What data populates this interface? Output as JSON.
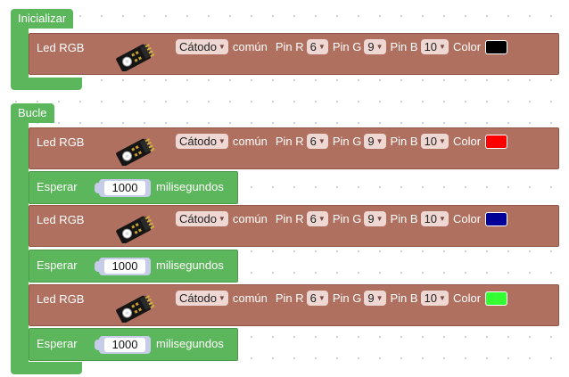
{
  "setup": {
    "label": "Inicializar",
    "led": {
      "label": "Led RGB",
      "cathode": "Cátodo",
      "common": "común",
      "pin_r_label": "Pin R",
      "pin_r": "6",
      "pin_g_label": "Pin G",
      "pin_g": "9",
      "pin_b_label": "Pin B",
      "pin_b": "10",
      "color_label": "Color",
      "color": "#000000"
    }
  },
  "loop": {
    "label": "Bucle",
    "steps": [
      {
        "led": {
          "label": "Led RGB",
          "cathode": "Cátodo",
          "common": "común",
          "pin_r_label": "Pin R",
          "pin_r": "6",
          "pin_g_label": "Pin G",
          "pin_g": "9",
          "pin_b_label": "Pin B",
          "pin_b": "10",
          "color_label": "Color",
          "color": "#ff0000"
        },
        "wait": {
          "label": "Esperar",
          "value": "1000",
          "unit": "milisegundos"
        }
      },
      {
        "led": {
          "label": "Led RGB",
          "cathode": "Cátodo",
          "common": "común",
          "pin_r_label": "Pin R",
          "pin_r": "6",
          "pin_g_label": "Pin G",
          "pin_g": "9",
          "pin_b_label": "Pin B",
          "pin_b": "10",
          "color_label": "Color",
          "color": "#000099"
        },
        "wait": {
          "label": "Esperar",
          "value": "1000",
          "unit": "milisegundos"
        }
      },
      {
        "led": {
          "label": "Led RGB",
          "cathode": "Cátodo",
          "common": "común",
          "pin_r_label": "Pin R",
          "pin_r": "6",
          "pin_g_label": "Pin G",
          "pin_g": "9",
          "pin_b_label": "Pin B",
          "pin_b": "10",
          "color_label": "Color",
          "color": "#33ff33"
        },
        "wait": {
          "label": "Esperar",
          "value": "1000",
          "unit": "milisegundos"
        }
      }
    ]
  }
}
